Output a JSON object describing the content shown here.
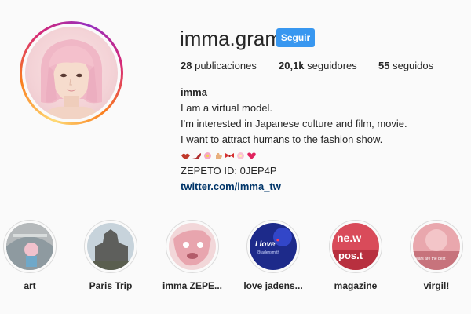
{
  "profile": {
    "username": "imma.gram",
    "follow_label": "Seguir",
    "stats": {
      "posts_count": "28",
      "posts_label": "publicaciones",
      "followers_count": "20,1k",
      "followers_label": "seguidores",
      "following_count": "55",
      "following_label": "seguidos"
    },
    "bio": {
      "name": "imma",
      "line1": "I am a virtual model.",
      "line2": "I'm interested in Japanese culture and film, movie.",
      "line3": "I want to attract humans to the fashion show.",
      "emoji_icons": [
        "lips-icon",
        "heels-icon",
        "flower-icon",
        "hand-icon",
        "bow-icon",
        "blossom-icon",
        "heart-icon"
      ],
      "zepeto": "ZEPETO ID: 0JEP4P",
      "link": "twitter.com/imma_tw"
    }
  },
  "highlights": [
    {
      "label": "art"
    },
    {
      "label": "Paris Trip"
    },
    {
      "label": "imma ZEPE..."
    },
    {
      "label": "love jadens...",
      "cover_text": "I love",
      "cover_subtext": "@jadensmith"
    },
    {
      "label": "magazine",
      "cover_text": "ne.w",
      "cover_subtext": "pos.t"
    },
    {
      "label": "virgil!",
      "cover_text": "ears are the best"
    }
  ],
  "colors": {
    "accent": "#3897f0",
    "link": "#003569",
    "text": "#262626",
    "background": "#fafafa"
  }
}
